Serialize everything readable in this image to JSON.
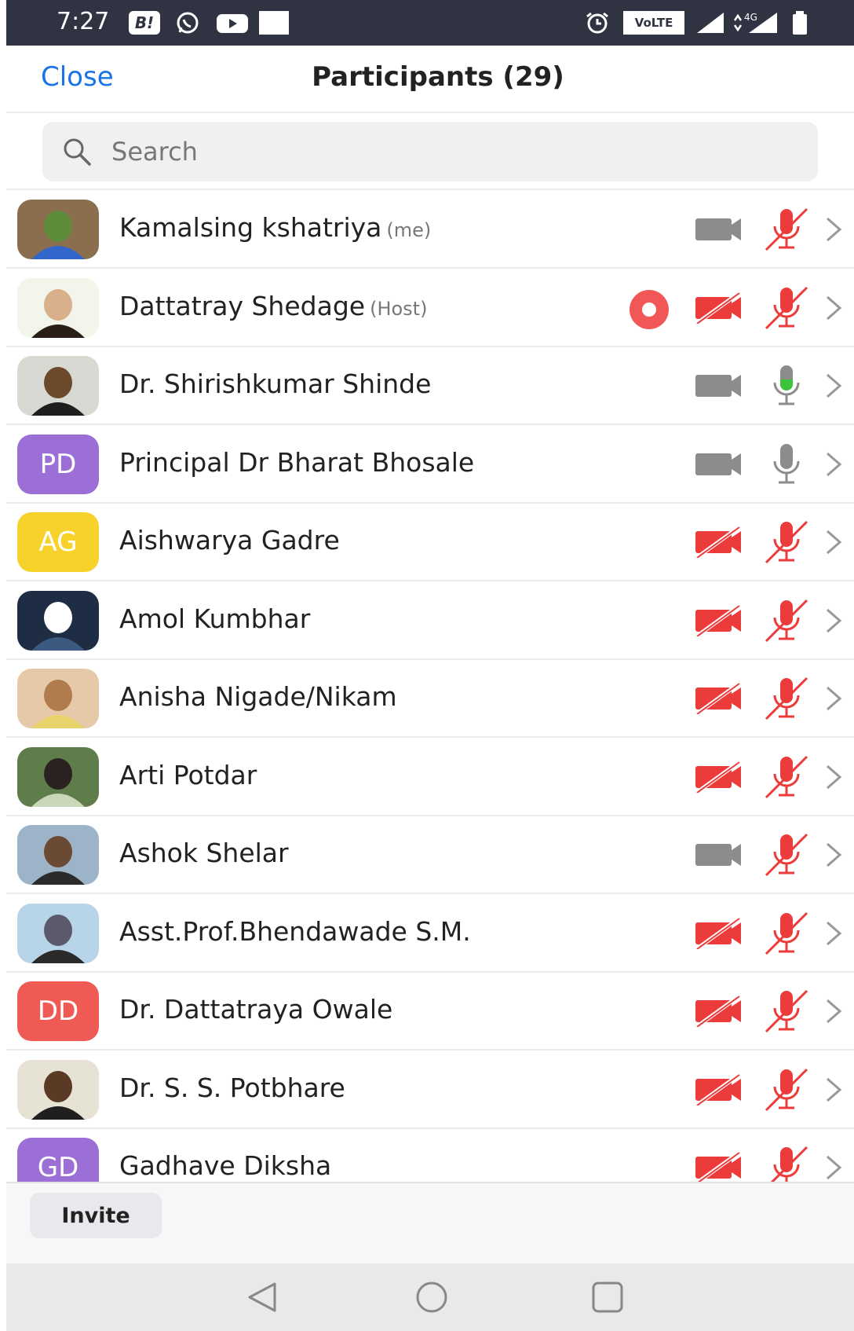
{
  "status_bar": {
    "time": "7:27",
    "b_label": "B!",
    "volte": "VoLTE",
    "net_type": "4G",
    "icons": [
      "whatsapp-icon",
      "youtube-icon",
      "notification-icon",
      "alarm-icon",
      "signal-icon",
      "battery-icon"
    ]
  },
  "header": {
    "close_label": "Close",
    "title": "Participants (29)"
  },
  "search": {
    "placeholder": "Search"
  },
  "participants": [
    {
      "name": "Kamalsing kshatriya",
      "tag": "(me)",
      "avatar": "photo",
      "recording": false,
      "video": "off-gray",
      "audio": "muted"
    },
    {
      "name": "Dattatray Shedage",
      "tag": "(Host)",
      "avatar": "photo",
      "recording": true,
      "video": "muted",
      "audio": "muted"
    },
    {
      "name": "Dr. Shirishkumar Shinde",
      "tag": "",
      "avatar": "photo",
      "recording": false,
      "video": "off-gray",
      "audio": "speaking"
    },
    {
      "name": "Principal Dr Bharat Bhosale",
      "tag": "",
      "avatar": "initials",
      "initials": "PD",
      "avatar_color": "#9c6fd6",
      "recording": false,
      "video": "off-gray",
      "audio": "on-gray"
    },
    {
      "name": "Aishwarya Gadre",
      "tag": "",
      "avatar": "initials",
      "initials": "AG",
      "avatar_color": "#f7d22b",
      "recording": false,
      "video": "muted",
      "audio": "muted"
    },
    {
      "name": "Amol Kumbhar",
      "tag": "",
      "avatar": "photo",
      "recording": false,
      "video": "muted",
      "audio": "muted"
    },
    {
      "name": "Anisha Nigade/Nikam",
      "tag": "",
      "avatar": "photo",
      "recording": false,
      "video": "muted",
      "audio": "muted"
    },
    {
      "name": "Arti Potdar",
      "tag": "",
      "avatar": "photo",
      "recording": false,
      "video": "muted",
      "audio": "muted"
    },
    {
      "name": "Ashok Shelar",
      "tag": "",
      "avatar": "photo",
      "recording": false,
      "video": "off-gray",
      "audio": "muted"
    },
    {
      "name": "Asst.Prof.Bhendawade S.M.",
      "tag": "",
      "avatar": "photo",
      "recording": false,
      "video": "muted",
      "audio": "muted"
    },
    {
      "name": "Dr. Dattatraya Owale",
      "tag": "",
      "avatar": "initials",
      "initials": "DD",
      "avatar_color": "#f05a55",
      "recording": false,
      "video": "muted",
      "audio": "muted"
    },
    {
      "name": "Dr. S. S. Potbhare",
      "tag": "",
      "avatar": "photo",
      "recording": false,
      "video": "muted",
      "audio": "muted"
    },
    {
      "name": "Gadhave Diksha",
      "tag": "",
      "avatar": "initials",
      "initials": "GD",
      "avatar_color": "#9c6fd6",
      "recording": false,
      "video": "muted",
      "audio": "muted"
    }
  ],
  "footer": {
    "invite_label": "Invite"
  },
  "colors": {
    "accent": "#1a73e8",
    "muted_red": "#ec3b3b",
    "speaking_green": "#3cc43c",
    "icon_gray": "#8c8c8c"
  }
}
